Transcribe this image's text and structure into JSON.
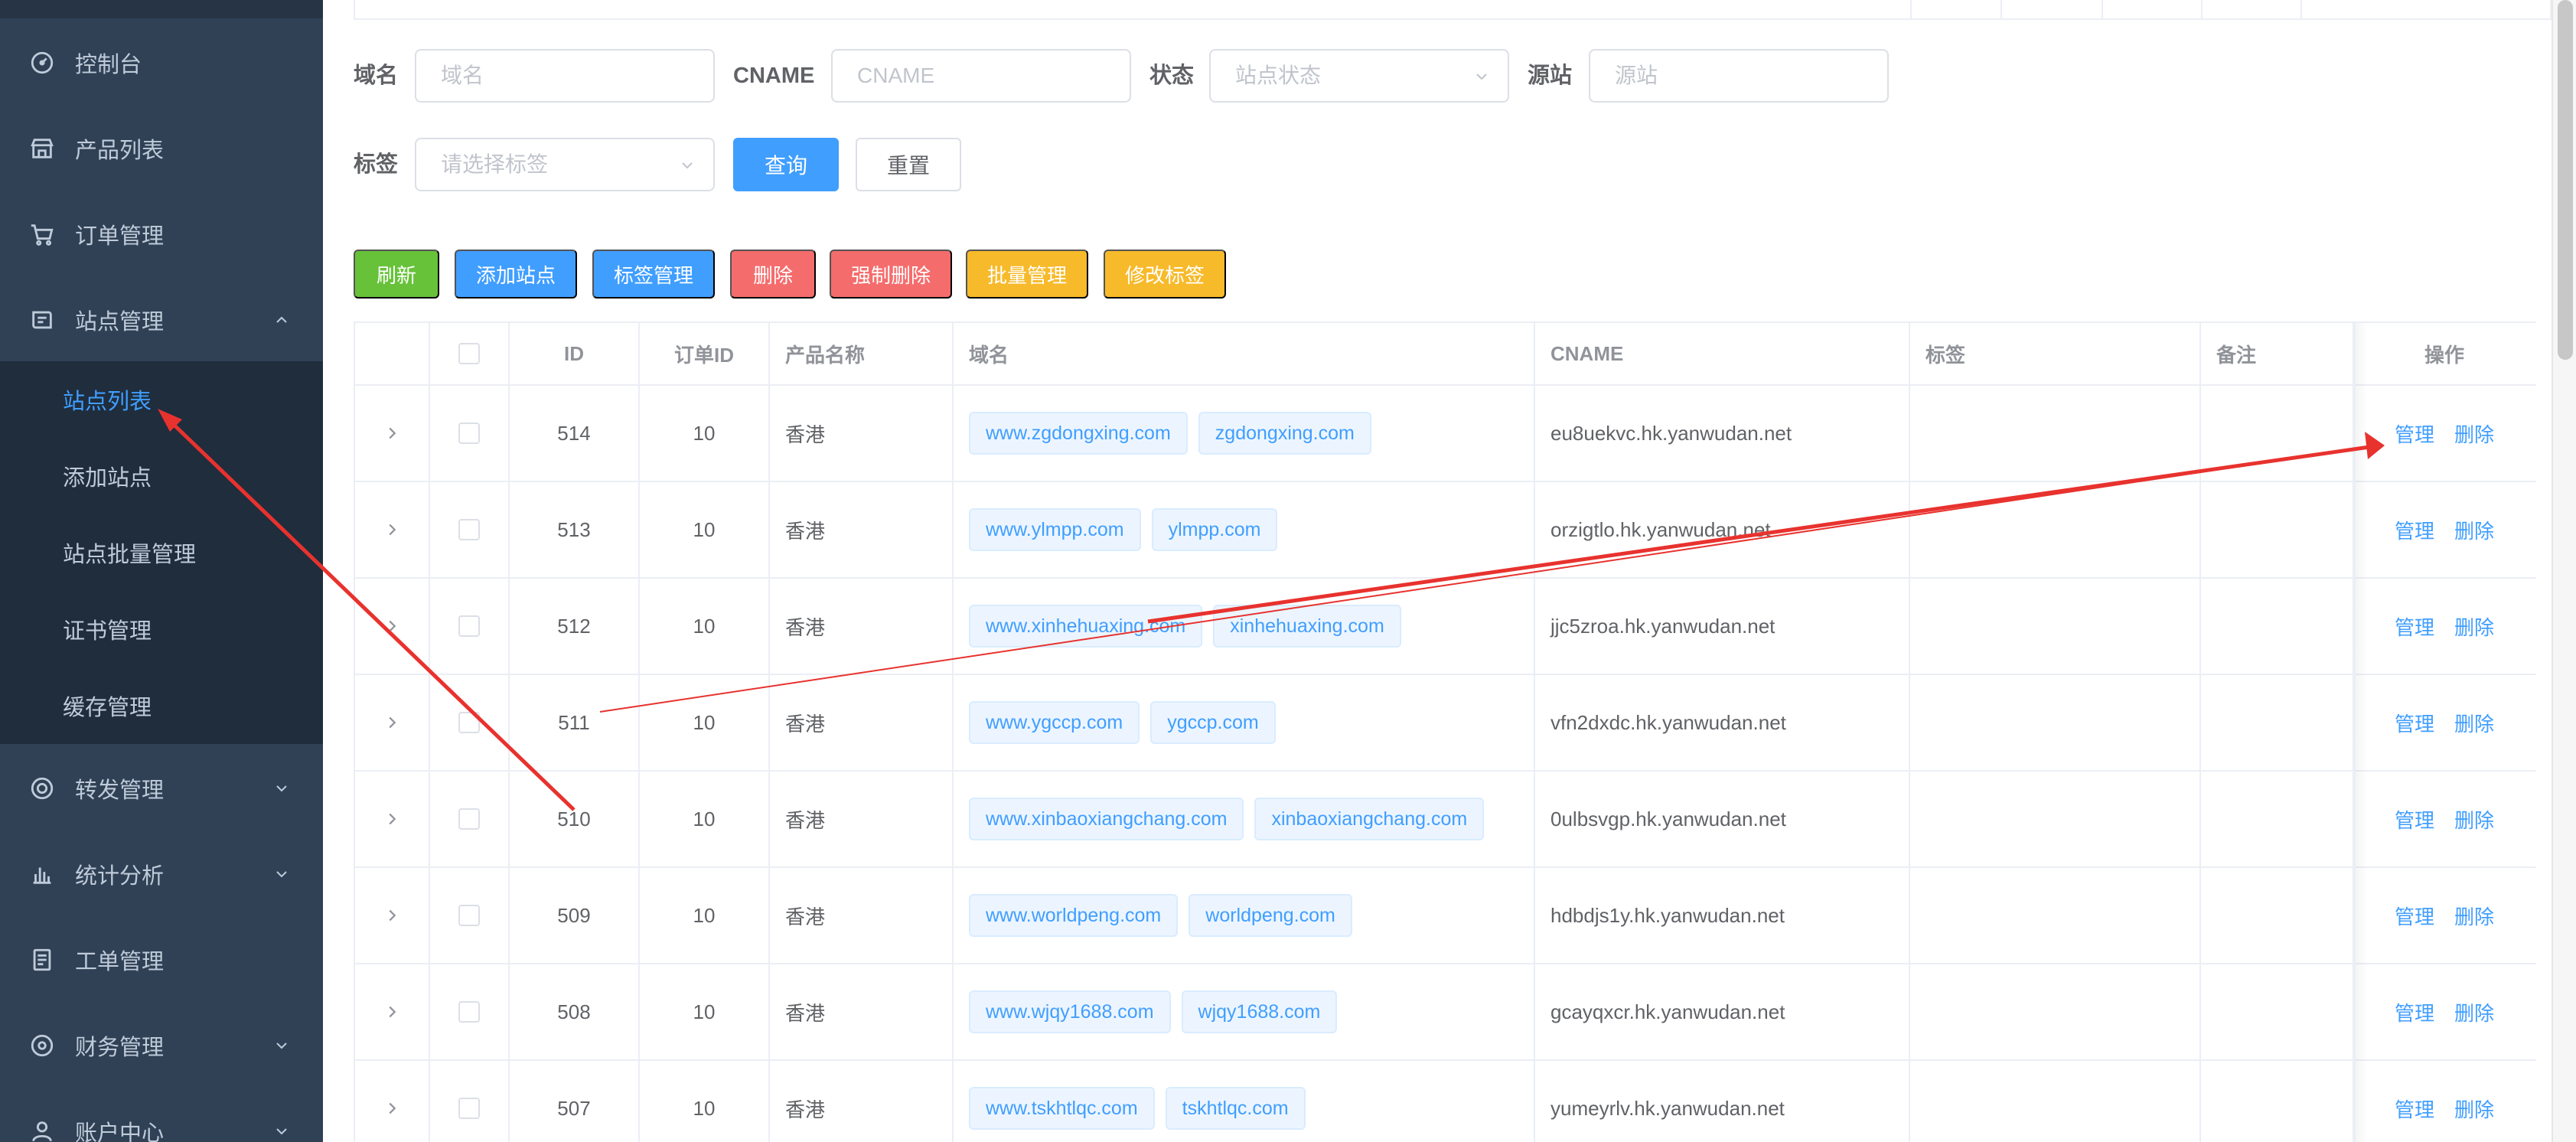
{
  "sidebar": {
    "items": [
      {
        "label": "控制台",
        "icon": "dashboard-icon"
      },
      {
        "label": "产品列表",
        "icon": "store-icon"
      },
      {
        "label": "订单管理",
        "icon": "cart-icon"
      },
      {
        "label": "站点管理",
        "icon": "site-icon",
        "expanded": true
      },
      {
        "label": "转发管理",
        "icon": "forward-icon"
      },
      {
        "label": "统计分析",
        "icon": "chart-icon"
      },
      {
        "label": "工单管理",
        "icon": "ticket-icon"
      },
      {
        "label": "财务管理",
        "icon": "finance-icon"
      },
      {
        "label": "账户中心",
        "icon": "account-icon"
      }
    ],
    "sub_items": [
      {
        "label": "站点列表",
        "active": true
      },
      {
        "label": "添加站点"
      },
      {
        "label": "站点批量管理"
      },
      {
        "label": "证书管理"
      },
      {
        "label": "缓存管理"
      }
    ]
  },
  "filters": {
    "domain_label": "域名",
    "domain_placeholder": "域名",
    "cname_label": "CNAME",
    "cname_placeholder": "CNAME",
    "status_label": "状态",
    "status_placeholder": "站点状态",
    "origin_label": "源站",
    "origin_placeholder": "源站",
    "tag_label": "标签",
    "tag_placeholder": "请选择标签",
    "query_button": "查询",
    "reset_button": "重置"
  },
  "toolbar": {
    "refresh": "刷新",
    "add_site": "添加站点",
    "tag_manage": "标签管理",
    "delete": "删除",
    "force_delete": "强制删除",
    "batch_manage": "批量管理",
    "edit_tags": "修改标签"
  },
  "colors": {
    "sidebar_bg": "#304156",
    "submenu_bg": "#1f2d3d",
    "active": "#409eff",
    "success": "#67c23a",
    "danger": "#f56c6c",
    "warning": "#f7ba2a",
    "annotation": "#e8322e"
  },
  "table": {
    "headers": {
      "id": "ID",
      "order_id": "订单ID",
      "product": "产品名称",
      "domain": "域名",
      "cname": "CNAME",
      "tags": "标签",
      "remark": "备注",
      "action": "操作"
    },
    "action_manage": "管理",
    "action_delete": "删除",
    "rows": [
      {
        "id": "514",
        "order_id": "10",
        "product": "香港",
        "domains": [
          "www.zgdongxing.com",
          "zgdongxing.com"
        ],
        "cname": "eu8uekvc.hk.yanwudan.net"
      },
      {
        "id": "513",
        "order_id": "10",
        "product": "香港",
        "domains": [
          "www.ylmpp.com",
          "ylmpp.com"
        ],
        "cname": "orzigtlo.hk.yanwudan.net"
      },
      {
        "id": "512",
        "order_id": "10",
        "product": "香港",
        "domains": [
          "www.xinhehuaxing.com",
          "xinhehuaxing.com"
        ],
        "cname": "jjc5zroa.hk.yanwudan.net"
      },
      {
        "id": "511",
        "order_id": "10",
        "product": "香港",
        "domains": [
          "www.ygccp.com",
          "ygccp.com"
        ],
        "cname": "vfn2dxdc.hk.yanwudan.net"
      },
      {
        "id": "510",
        "order_id": "10",
        "product": "香港",
        "domains": [
          "www.xinbaoxiangchang.com",
          "xinbaoxiangchang.com"
        ],
        "cname": "0ulbsvgp.hk.yanwudan.net"
      },
      {
        "id": "509",
        "order_id": "10",
        "product": "香港",
        "domains": [
          "www.worldpeng.com",
          "worldpeng.com"
        ],
        "cname": "hdbdjs1y.hk.yanwudan.net"
      },
      {
        "id": "508",
        "order_id": "10",
        "product": "香港",
        "domains": [
          "www.wjqy1688.com",
          "wjqy1688.com"
        ],
        "cname": "gcayqxcr.hk.yanwudan.net"
      },
      {
        "id": "507",
        "order_id": "10",
        "product": "香港",
        "domains": [
          "www.tskhtlqc.com",
          "tskhtlqc.com"
        ],
        "cname": "yumeyrlv.hk.yanwudan.net"
      }
    ]
  }
}
